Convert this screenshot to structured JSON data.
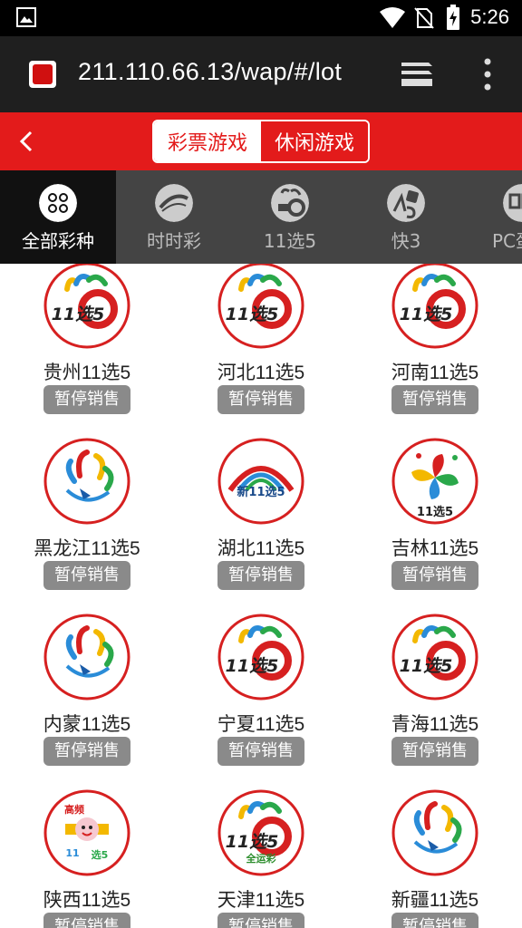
{
  "status_bar": {
    "time": "5:26"
  },
  "browser": {
    "url": "211.110.66.13/wap/#/lot"
  },
  "header": {
    "segments": [
      "彩票游戏",
      "休闲游戏"
    ],
    "active_segment": "彩票游戏"
  },
  "categories": [
    {
      "label": "全部彩种",
      "icon": "grid-icon",
      "active": true
    },
    {
      "label": "时时彩",
      "icon": "shishicai-logo-icon",
      "active": false
    },
    {
      "label": "11选5",
      "icon": "11x5-logo-icon",
      "active": false
    },
    {
      "label": "快3",
      "icon": "k3-dice-logo-icon",
      "active": false
    },
    {
      "label": "PC蛋蛋",
      "icon": "pc-logo-icon",
      "active": false
    }
  ],
  "lotteries": [
    {
      "name": "贵州11选5",
      "status": "暂停销售",
      "logo": "11x5-logo"
    },
    {
      "name": "河北11选5",
      "status": "暂停销售",
      "logo": "11x5-logo"
    },
    {
      "name": "河南11选5",
      "status": "暂停销售",
      "logo": "11x5-logo"
    },
    {
      "name": "黑龙江11选5",
      "status": "暂停销售",
      "logo": "rainbow-swirl-logo"
    },
    {
      "name": "湖北11选5",
      "status": "暂停销售",
      "logo": "rainbow-arc-logo"
    },
    {
      "name": "吉林11选5",
      "status": "暂停销售",
      "logo": "pinwheel-logo"
    },
    {
      "name": "内蒙11选5",
      "status": "暂停销售",
      "logo": "rainbow-swirl-logo"
    },
    {
      "name": "宁夏11选5",
      "status": "暂停销售",
      "logo": "11x5-logo"
    },
    {
      "name": "青海11选5",
      "status": "暂停销售",
      "logo": "11x5-logo"
    },
    {
      "name": "陕西11选5",
      "status": "暂停销售",
      "logo": "cartoon-logo"
    },
    {
      "name": "天津11选5",
      "status": "暂停销售",
      "logo": "11x5-logo"
    },
    {
      "name": "新疆11选5",
      "status": "暂停销售",
      "logo": "rainbow-swirl-logo"
    }
  ],
  "logo_text": {
    "x5": "11选5",
    "tianjin_sub": "全运彩",
    "shaanxi_top": "高频",
    "shaanxi_mid": "11",
    "shaanxi_bot": "选5",
    "hubei": "新11选5",
    "jilin": "11选5"
  },
  "colors": {
    "brand_red": "#e31b1b",
    "badge_gray": "#8a8a8a"
  }
}
